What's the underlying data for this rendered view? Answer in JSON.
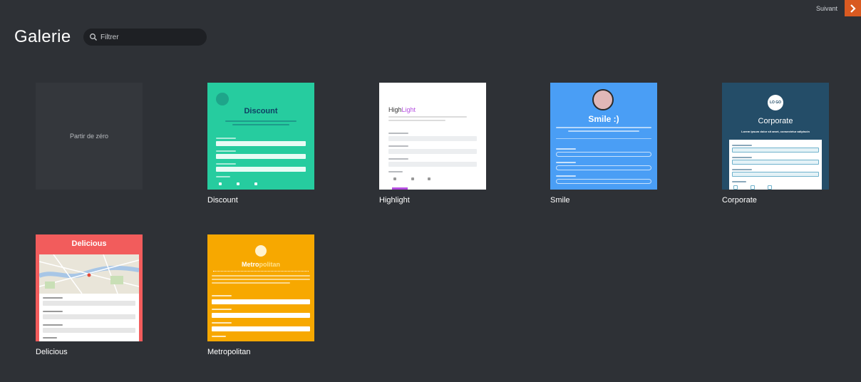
{
  "header": {
    "title": "Galerie",
    "search_placeholder": "Filtrer",
    "next_label": "Suivant"
  },
  "gallery": {
    "blank_label": "Partir de zéro",
    "templates": [
      {
        "name": "Discount",
        "title": "Discount"
      },
      {
        "name": "Highlight",
        "title_part1": "High",
        "title_part2": "Light"
      },
      {
        "name": "Smile",
        "title": "Smile :)"
      },
      {
        "name": "Corporate",
        "title": "Corporate",
        "logo_text": "LO GO",
        "subtitle": "Lorem ipsum dolor sit amet, consectetur adipiscin"
      },
      {
        "name": "Delicious",
        "title": "Delicious"
      },
      {
        "name": "Metropolitan",
        "title_part1": "Metro",
        "title_part2": "politan"
      }
    ]
  },
  "colors": {
    "accent": "#d95a21",
    "background": "#2e3136",
    "discount": "#26cc9f",
    "smile": "#4a9ef5",
    "corporate": "#244d68",
    "delicious": "#f25c5c",
    "metropolitan": "#f7a800",
    "highlight_accent": "#b44de0"
  }
}
